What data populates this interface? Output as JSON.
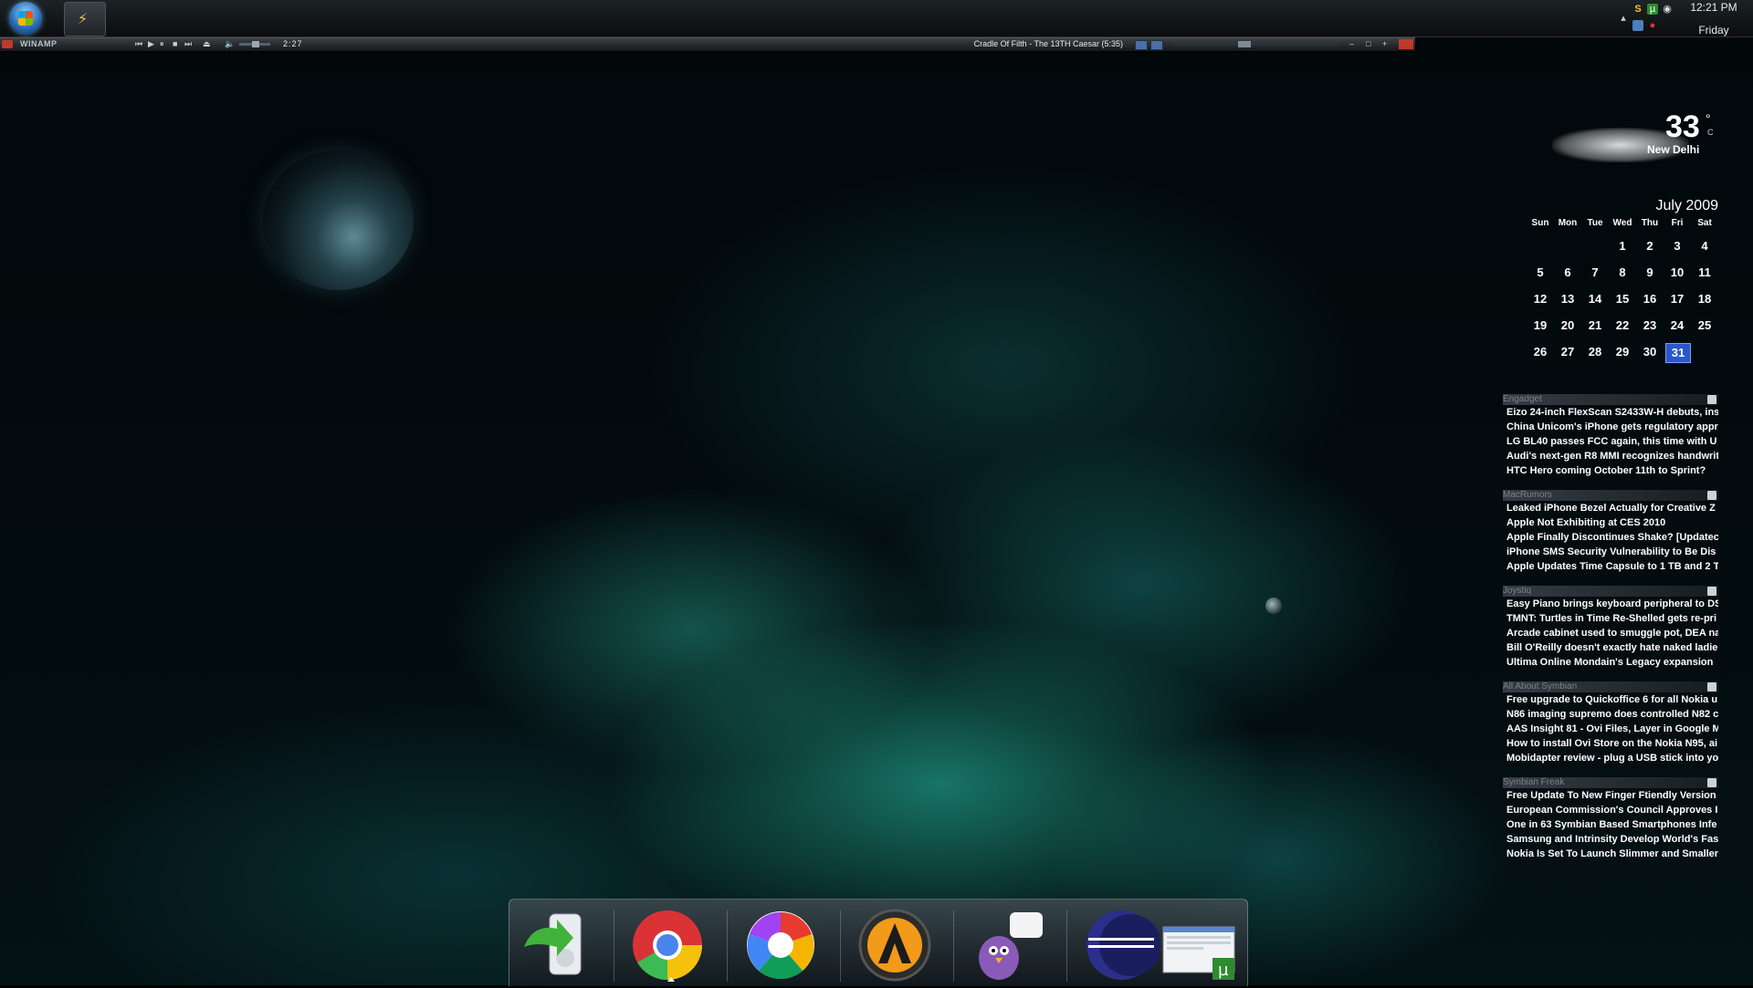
{
  "taskbar": {
    "start": "start-button",
    "pinned_app": "winamp-taskbar-icon",
    "tray_icons": [
      "skype-icon",
      "utorrent-icon",
      "network-icon",
      "volume-icon",
      "power-icon",
      "arrow-up-icon"
    ],
    "clock": {
      "time": "12:21 PM",
      "day": "Friday"
    }
  },
  "winamp": {
    "app_name": "WINAMP",
    "time": "2:27",
    "track": "Cradle Of Filth - The 13TH Caesar (5:35)"
  },
  "weather": {
    "temperature": "33",
    "degree": "°",
    "unit": "C",
    "city": "New Delhi"
  },
  "calendar": {
    "title": "July 2009",
    "weekdays": [
      "Sun",
      "Mon",
      "Tue",
      "Wed",
      "Thu",
      "Fri",
      "Sat"
    ],
    "weeks": [
      [
        "",
        "",
        "",
        "1",
        "2",
        "3",
        "4"
      ],
      [
        "5",
        "6",
        "7",
        "8",
        "9",
        "10",
        "11"
      ],
      [
        "12",
        "13",
        "14",
        "15",
        "16",
        "17",
        "18"
      ],
      [
        "19",
        "20",
        "21",
        "22",
        "23",
        "24",
        "25"
      ],
      [
        "26",
        "27",
        "28",
        "29",
        "30",
        "31",
        ""
      ]
    ],
    "today": "31"
  },
  "feeds": [
    {
      "source": "Engadget",
      "items": [
        "Eizo 24-inch FlexScan S2433W-H debuts, ins",
        "China Unicom's iPhone gets regulatory appr",
        "LG BL40 passes FCC again, this time with U",
        "Audi's next-gen R8 MMI recognizes handwrit",
        "HTC Hero coming October 11th to Sprint?"
      ]
    },
    {
      "source": "MacRumors",
      "items": [
        "Leaked iPhone Bezel Actually for Creative Z",
        "Apple Not Exhibiting at CES 2010",
        "Apple Finally Discontinues Shake? [Updatec",
        "iPhone SMS Security Vulnerability to Be Dis",
        "Apple Updates Time Capsule to 1 TB and 2 T"
      ]
    },
    {
      "source": "Joystiq",
      "items": [
        "Easy Piano brings keyboard peripheral to DS",
        "TMNT: Turtles in Time Re-Shelled gets re-pri",
        "Arcade cabinet used to smuggle pot, DEA na",
        "Bill O'Reilly doesn't exactly hate naked ladie",
        "Ultima Online Mondain's Legacy expansion"
      ]
    },
    {
      "source": "All About Symbian",
      "items": [
        "Free upgrade to Quickoffice 6 for all Nokia u",
        "N86 imaging supremo does controlled N82 c",
        "AAS Insight 81 - Ovi Files, Layer in Google M",
        "How to install Ovi Store on the Nokia N95, ai",
        "Mobidapter review - plug a USB stick into yo"
      ]
    },
    {
      "source": "Symbian Freak",
      "items": [
        "Free Update To New Finger Ftiendly Version",
        "European Commission's Council Approves I",
        "One in 63 Symbian Based Smartphones Infe",
        "Samsung and Intrinsity Develop World's Fas",
        "Nokia Is Set To Launch Slimmer and Smaller"
      ]
    }
  ],
  "dock": [
    "ipod-sync-icon",
    "chrome-icon",
    "picasa-icon",
    "aimp-icon",
    "pidgin-icon",
    "eclipse-icon",
    "utorrent-window-icon"
  ]
}
